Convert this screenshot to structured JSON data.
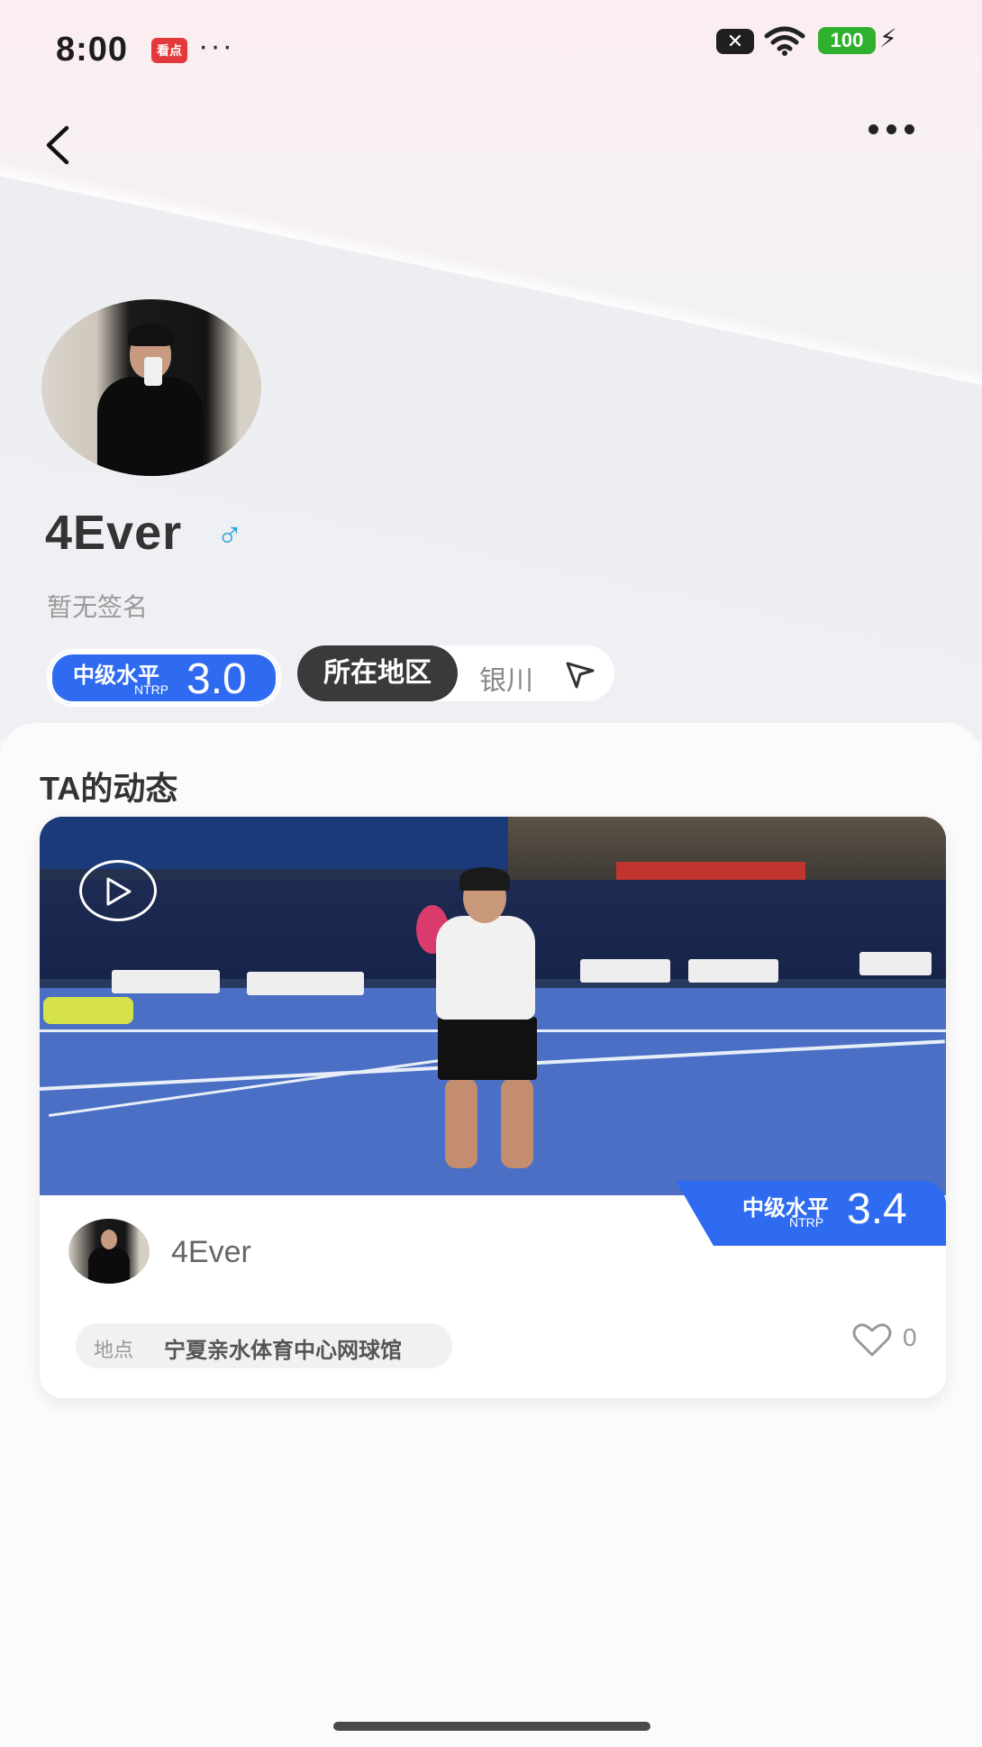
{
  "status_bar": {
    "time": "8:00",
    "app_badge": "看点",
    "more_dots": "···",
    "sim_icon": "x-icon",
    "battery": "100"
  },
  "nav": {
    "back_icon": "chevron-left-icon",
    "more_icon": "more-horizontal-icon"
  },
  "profile": {
    "username": "4Ever",
    "gender_symbol": "♂",
    "signature": "暂无签名",
    "level": {
      "label": "中级水平",
      "sub": "NTRP",
      "value": "3.0"
    },
    "region": {
      "label": "所在地区",
      "value": "银川"
    }
  },
  "feed": {
    "section_title": "TA的动态",
    "posts": [
      {
        "username": "4Ever",
        "level": {
          "label": "中级水平",
          "sub": "NTRP",
          "value": "3.4"
        },
        "location_key": "地点",
        "location_value": "宁夏亲水体育中心网球馆",
        "likes": "0"
      }
    ]
  },
  "colors": {
    "accent_blue": "#2f6bf0",
    "dark_pill": "#3a3a3a",
    "gender_blue": "#2aa3d6",
    "battery_green": "#2fb12f"
  }
}
